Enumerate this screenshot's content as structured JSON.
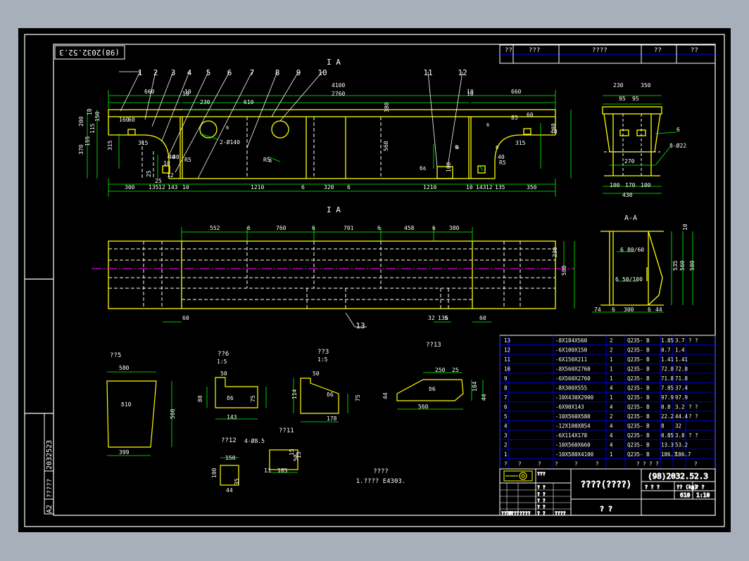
{
  "colors": {
    "background": "#000000",
    "frame": "#ffffff",
    "outline": "#ffff00",
    "dimension": "#00ff00",
    "centerline": "#ff00ff",
    "table": "#0000ff",
    "text": "#ffffff",
    "outer": "#a7afbb"
  },
  "stamp": {
    "top": "(98)2032.52.3",
    "side_num": "2032523",
    "side_a2": "A2",
    "side_qs": "?????"
  },
  "top_header": [
    "??",
    "???",
    "????",
    "??",
    "??"
  ],
  "section_marks": {
    "top": "I A",
    "mid": "I A",
    "aa": "A-A"
  },
  "balloons": [
    "1",
    "2",
    "3",
    "4",
    "5",
    "6",
    "7",
    "8",
    "9",
    "10",
    "11",
    "12",
    "13"
  ],
  "front_dims": {
    "top": [
      "660",
      "10",
      "4100",
      "2760",
      "10",
      "660",
      "230",
      "610",
      "160",
      "60",
      "315",
      "10",
      "10",
      "40",
      "85",
      "60",
      "315",
      "40",
      "40",
      "10"
    ],
    "bottom": [
      "300",
      "135",
      "12",
      "143",
      "10",
      "1210",
      "6",
      "320",
      "6",
      "1210",
      "10",
      "143",
      "12",
      "135",
      "350",
      "25",
      "315",
      "560",
      "370",
      "155",
      "115",
      "150",
      "200",
      "10",
      "380",
      "40",
      "40",
      "25",
      "12",
      "100",
      "6",
      "6",
      "R5",
      "R5",
      "2-Ø140",
      "R5"
    ],
    "weld": [
      "6",
      "6",
      "6",
      "6",
      "6",
      "6"
    ]
  },
  "side_dims": [
    "230",
    "350",
    "95",
    "95",
    "270",
    "100",
    "170",
    "100",
    "430",
    "6",
    "8-Ø22"
  ],
  "plan_dims": [
    "552",
    "6",
    "760",
    "6",
    "701",
    "6",
    "458",
    "6",
    "380",
    "230",
    "580",
    "60",
    "60",
    "32",
    "135",
    "6"
  ],
  "section_aa_dims": [
    "10",
    "535",
    "560",
    "580",
    "74",
    "6",
    "300",
    "6",
    "44",
    "6",
    "80/60",
    "6",
    "50/100"
  ],
  "details": [
    {
      "title": "??5",
      "dims": [
        "580",
        "δ10",
        "560",
        "399"
      ]
    },
    {
      "title": "??6",
      "scale": "1:5",
      "dims": [
        "50",
        "80",
        "δ6",
        "75",
        "143"
      ]
    },
    {
      "title": "??3",
      "scale": "1:5",
      "dims": [
        "50",
        "114",
        "δ6",
        "75",
        "178"
      ]
    },
    {
      "title": "??13",
      "dims": [
        "250",
        "25",
        "δ6",
        "44",
        "560",
        "44",
        "184"
      ]
    },
    {
      "title": "??12",
      "dims": [
        "150",
        "100",
        "44",
        "35"
      ]
    },
    {
      "title": "??11",
      "dims": [
        "4-Ø8.5",
        "13",
        "185",
        "50",
        "15",
        "15"
      ]
    }
  ],
  "note": {
    "title": "????",
    "body": "1.???? E4303."
  },
  "bom_rows": [
    [
      "13",
      "-8X184X560",
      "2",
      "Q235- B",
      "1.85",
      "3.7",
      "? ?"
    ],
    [
      "12",
      "-6X100X150",
      "2",
      "Q235- B",
      "0.7",
      "1.4",
      ""
    ],
    [
      "11",
      "-6X150X211",
      "1",
      "Q235- B",
      "1.41",
      "1.41",
      ""
    ],
    [
      "10",
      "-8X560X2760",
      "1",
      "Q235- B",
      "72.8",
      "72.8",
      ""
    ],
    [
      "9",
      "-6X560X2760",
      "1",
      "Q235- B",
      "71.8",
      "71.8",
      ""
    ],
    [
      "8",
      "-8X300X555",
      "4",
      "Q235- B",
      "7.85",
      "37.4",
      ""
    ],
    [
      "7",
      "-10X430X2900",
      "1",
      "Q235- B",
      "97.9",
      "97.9",
      ""
    ],
    [
      "6",
      "-6X90X143",
      "4",
      "Q235- B",
      "0.8",
      "3.2",
      "? ?"
    ],
    [
      "5",
      "-10X560X580",
      "2",
      "Q235- B",
      "22.2",
      "44.4",
      "? ?"
    ],
    [
      "4",
      "-12X100X854",
      "4",
      "Q235- B",
      "8",
      "32",
      ""
    ],
    [
      "3",
      "-6X114X178",
      "4",
      "Q235- B",
      "0.85",
      "3.8",
      "? ?"
    ],
    [
      "2",
      "-10X560X660",
      "4",
      "Q235- B",
      "13.3",
      "53.2",
      ""
    ],
    [
      "1",
      "-10X580X4100",
      "1",
      "Q235- B",
      "186.7",
      "186.7",
      ""
    ]
  ],
  "bom_header": [
    "?",
    "?",
    "?",
    "?",
    "?",
    "?",
    "? ? ? ?",
    "?"
  ],
  "title_block": {
    "name": "????(????)",
    "drawing_no": "(98)2032.52.3",
    "sub": "? ?",
    "row_labels": [
      "? ? ?",
      "?? (kg)",
      "? ?"
    ],
    "weight": "610",
    "scale": "1:10",
    "small": [
      "???",
      "? ?",
      "? ?",
      "? ?",
      "? ?",
      "? ?",
      "????",
      "????",
      "????",
      "????"
    ]
  }
}
